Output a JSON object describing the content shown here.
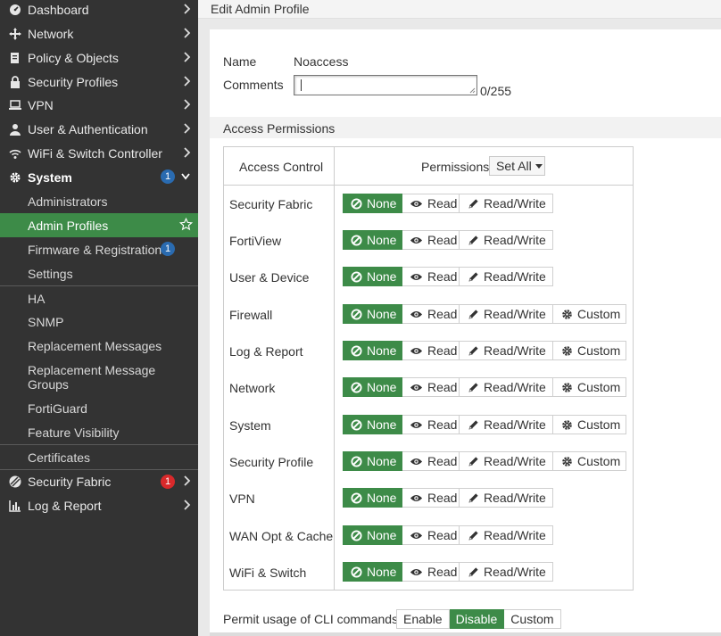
{
  "sidebar": {
    "top": [
      {
        "label": "Dashboard",
        "icon": "dashboard-icon"
      },
      {
        "label": "Network",
        "icon": "network-icon"
      },
      {
        "label": "Policy & Objects",
        "icon": "policy-icon"
      },
      {
        "label": "Security Profiles",
        "icon": "lock-icon"
      },
      {
        "label": "VPN",
        "icon": "laptop-icon"
      },
      {
        "label": "User & Authentication",
        "icon": "user-icon"
      },
      {
        "label": "WiFi & Switch Controller",
        "icon": "wifi-icon"
      }
    ],
    "system": {
      "label": "System",
      "icon": "gear-icon",
      "badge": "1"
    },
    "system_items": [
      {
        "label": "Administrators"
      },
      {
        "label": "Admin Profiles"
      },
      {
        "label": "Firmware & Registration",
        "badge": "1"
      },
      {
        "label": "Settings"
      },
      {
        "label": "HA"
      },
      {
        "label": "SNMP"
      },
      {
        "label": "Replacement Messages"
      },
      {
        "label": "Replacement Message Groups"
      },
      {
        "label": "FortiGuard"
      },
      {
        "label": "Feature Visibility"
      },
      {
        "label": "Certificates"
      }
    ],
    "bottom": [
      {
        "label": "Security Fabric",
        "icon": "fabric-icon",
        "badge": "1"
      },
      {
        "label": "Log & Report",
        "icon": "chart-icon"
      }
    ]
  },
  "header": {
    "title": "Edit Admin Profile"
  },
  "form": {
    "name_label": "Name",
    "name_value": "Noaccess",
    "comments_label": "Comments",
    "comments_value": "",
    "comments_counter": "0/255"
  },
  "permissions": {
    "section_title": "Access Permissions",
    "col_access_control": "Access Control",
    "col_permissions": "Permissions",
    "set_all": "Set All",
    "options": {
      "none": "None",
      "read": "Read",
      "rw": "Read/Write",
      "custom": "Custom"
    },
    "rows": [
      {
        "label": "Security Fabric",
        "selected": "None"
      },
      {
        "label": "FortiView",
        "selected": "None"
      },
      {
        "label": "User & Device",
        "selected": "None"
      },
      {
        "label": "Firewall",
        "selected": "None"
      },
      {
        "label": "Log & Report",
        "selected": "None"
      },
      {
        "label": "Network",
        "selected": "None"
      },
      {
        "label": "System",
        "selected": "None"
      },
      {
        "label": "Security Profile",
        "selected": "None"
      },
      {
        "label": "VPN",
        "selected": "None"
      },
      {
        "label": "WAN Opt & Cache",
        "selected": "None"
      },
      {
        "label": "WiFi & Switch",
        "selected": "None"
      }
    ]
  },
  "cli": {
    "label": "Permit usage of CLI commands",
    "options": [
      "Enable",
      "Disable",
      "Custom"
    ],
    "selected": "Disable"
  },
  "colors": {
    "accent_green": "#3d8b48",
    "sidebar_bg": "#333333",
    "badge_blue": "#2a6bb0",
    "badge_red": "#d9292b"
  }
}
